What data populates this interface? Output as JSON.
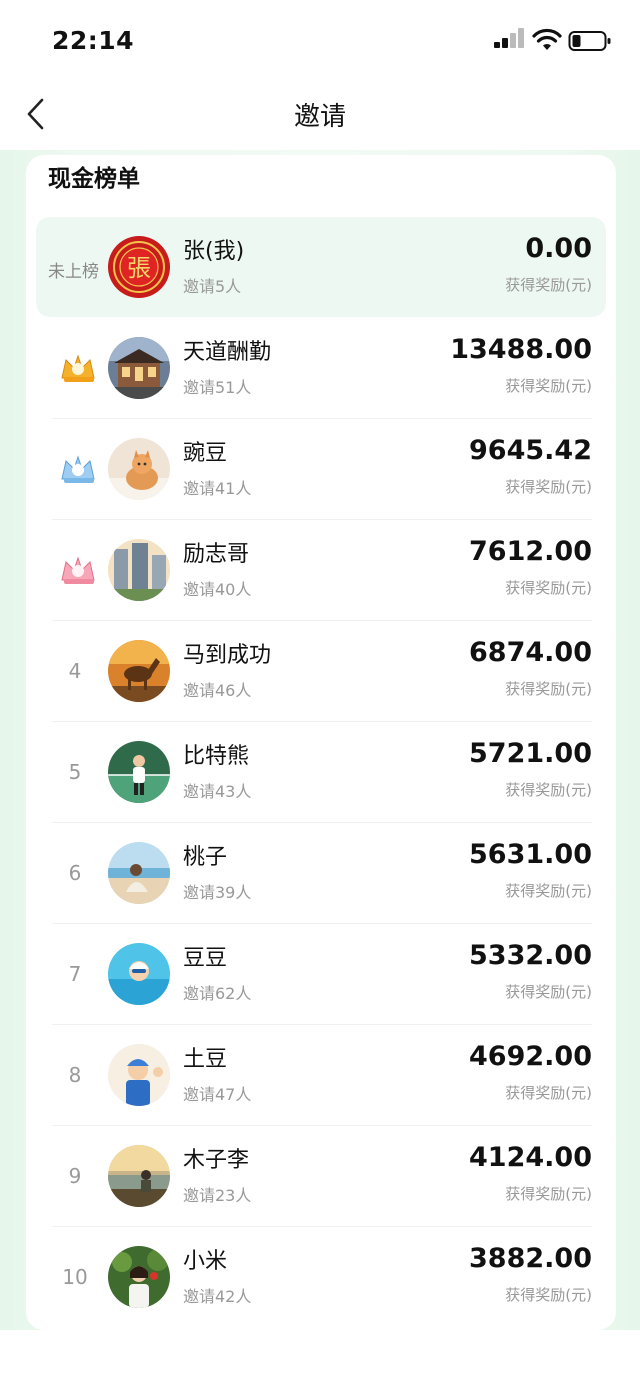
{
  "status": {
    "time": "22:14"
  },
  "nav": {
    "title": "邀请"
  },
  "card": {
    "title": "现金榜单"
  },
  "self": {
    "rank_label": "未上榜",
    "name": "张(我)",
    "invites": "邀请5人",
    "amount": "0.00",
    "reward_label": "获得奖励(元)",
    "avatar_char": "張"
  },
  "rows": [
    {
      "rank": "1",
      "name": "天道酬勤",
      "invites": "邀请51人",
      "amount": "13488.00",
      "reward_label": "获得奖励(元)"
    },
    {
      "rank": "2",
      "name": "豌豆",
      "invites": "邀请41人",
      "amount": "9645.42",
      "reward_label": "获得奖励(元)"
    },
    {
      "rank": "3",
      "name": "励志哥",
      "invites": "邀请40人",
      "amount": "7612.00",
      "reward_label": "获得奖励(元)"
    },
    {
      "rank": "4",
      "name": "马到成功",
      "invites": "邀请46人",
      "amount": "6874.00",
      "reward_label": "获得奖励(元)"
    },
    {
      "rank": "5",
      "name": "比特熊",
      "invites": "邀请43人",
      "amount": "5721.00",
      "reward_label": "获得奖励(元)"
    },
    {
      "rank": "6",
      "name": "桃子",
      "invites": "邀请39人",
      "amount": "5631.00",
      "reward_label": "获得奖励(元)"
    },
    {
      "rank": "7",
      "name": "豆豆",
      "invites": "邀请62人",
      "amount": "5332.00",
      "reward_label": "获得奖励(元)"
    },
    {
      "rank": "8",
      "name": "土豆",
      "invites": "邀请47人",
      "amount": "4692.00",
      "reward_label": "获得奖励(元)"
    },
    {
      "rank": "9",
      "name": "木子李",
      "invites": "邀请23人",
      "amount": "4124.00",
      "reward_label": "获得奖励(元)"
    },
    {
      "rank": "10",
      "name": "小米",
      "invites": "邀请42人",
      "amount": "3882.00",
      "reward_label": "获得奖励(元)"
    }
  ],
  "colors": {
    "accent_green": "#eef8f2",
    "gold": "#f5a623",
    "silver": "#7ab8e8",
    "bronze": "#f08aa0"
  }
}
